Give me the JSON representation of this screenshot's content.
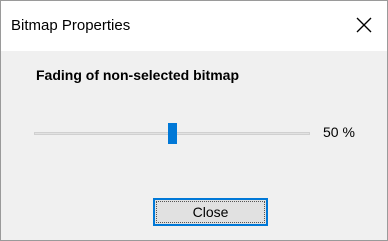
{
  "window": {
    "title": "Bitmap Properties",
    "close_icon": "close-icon"
  },
  "content": {
    "heading": "Fading of non-selected bitmap",
    "slider": {
      "value": 50,
      "min": 0,
      "max": 100,
      "label": "50 %"
    }
  },
  "buttons": {
    "close_label": "Close"
  },
  "colors": {
    "accent": "#0078d7",
    "dialog_bg": "#f0f0f0",
    "button_bg": "#e1e1e1"
  }
}
